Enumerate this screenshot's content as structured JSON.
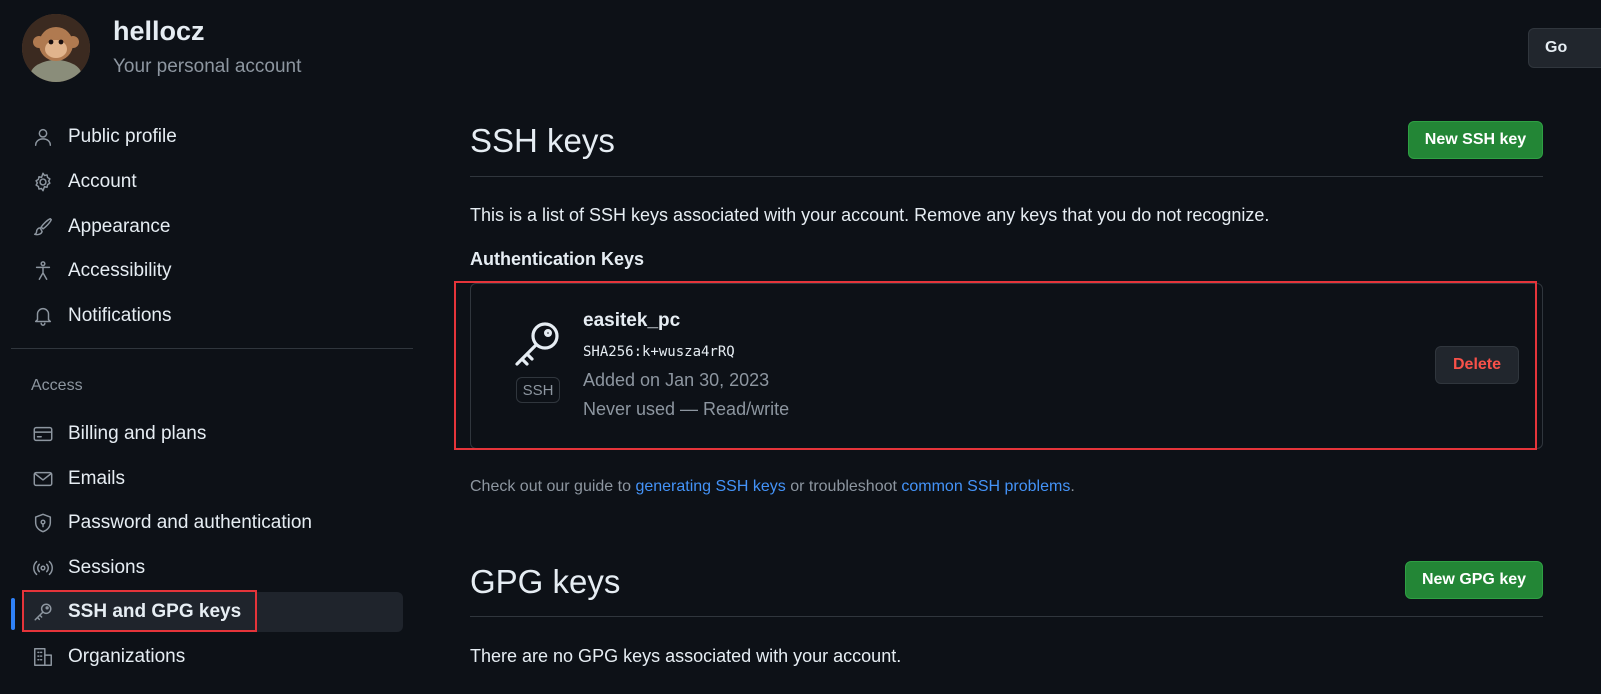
{
  "header": {
    "username": "hellocz",
    "subtitle": "Your personal account",
    "go_button": "Go"
  },
  "sidebar": {
    "items": [
      {
        "label": "Public profile",
        "icon": "person-icon"
      },
      {
        "label": "Account",
        "icon": "gear-icon"
      },
      {
        "label": "Appearance",
        "icon": "paintbrush-icon"
      },
      {
        "label": "Accessibility",
        "icon": "accessibility-icon"
      },
      {
        "label": "Notifications",
        "icon": "bell-icon"
      }
    ],
    "access_label": "Access",
    "access_items": [
      {
        "label": "Billing and plans",
        "icon": "credit-card-icon"
      },
      {
        "label": "Emails",
        "icon": "mail-icon"
      },
      {
        "label": "Password and authentication",
        "icon": "shield-lock-icon"
      },
      {
        "label": "Sessions",
        "icon": "broadcast-icon"
      },
      {
        "label": "SSH and GPG keys",
        "icon": "key-icon",
        "active": true
      },
      {
        "label": "Organizations",
        "icon": "organization-icon"
      }
    ],
    "active_color": "#2f81f7"
  },
  "main": {
    "ssh_title": "SSH keys",
    "new_ssh_button": "New SSH key",
    "description": "This is a list of SSH keys associated with your account. Remove any keys that you do not recognize.",
    "auth_title": "Authentication Keys",
    "key": {
      "name": "easitek_pc",
      "badge": "SSH",
      "fingerprint": "SHA256:k+wusza4rRQ",
      "added": "Added on Jan 30, 2023",
      "usage": "Never used — Read/write",
      "delete_label": "Delete"
    },
    "guide": {
      "prefix": "Check out our guide to ",
      "link1": "generating SSH keys",
      "middle": " or troubleshoot ",
      "link2": "common SSH problems",
      "suffix": "."
    },
    "gpg_title": "GPG keys",
    "new_gpg_button": "New GPG key",
    "gpg_empty": "There are no GPG keys associated with your account."
  },
  "colors": {
    "background": "#0d1117",
    "primary_button": "#238636",
    "danger": "#f85149",
    "link": "#4493f8",
    "highlight_box": "#e5343a"
  }
}
